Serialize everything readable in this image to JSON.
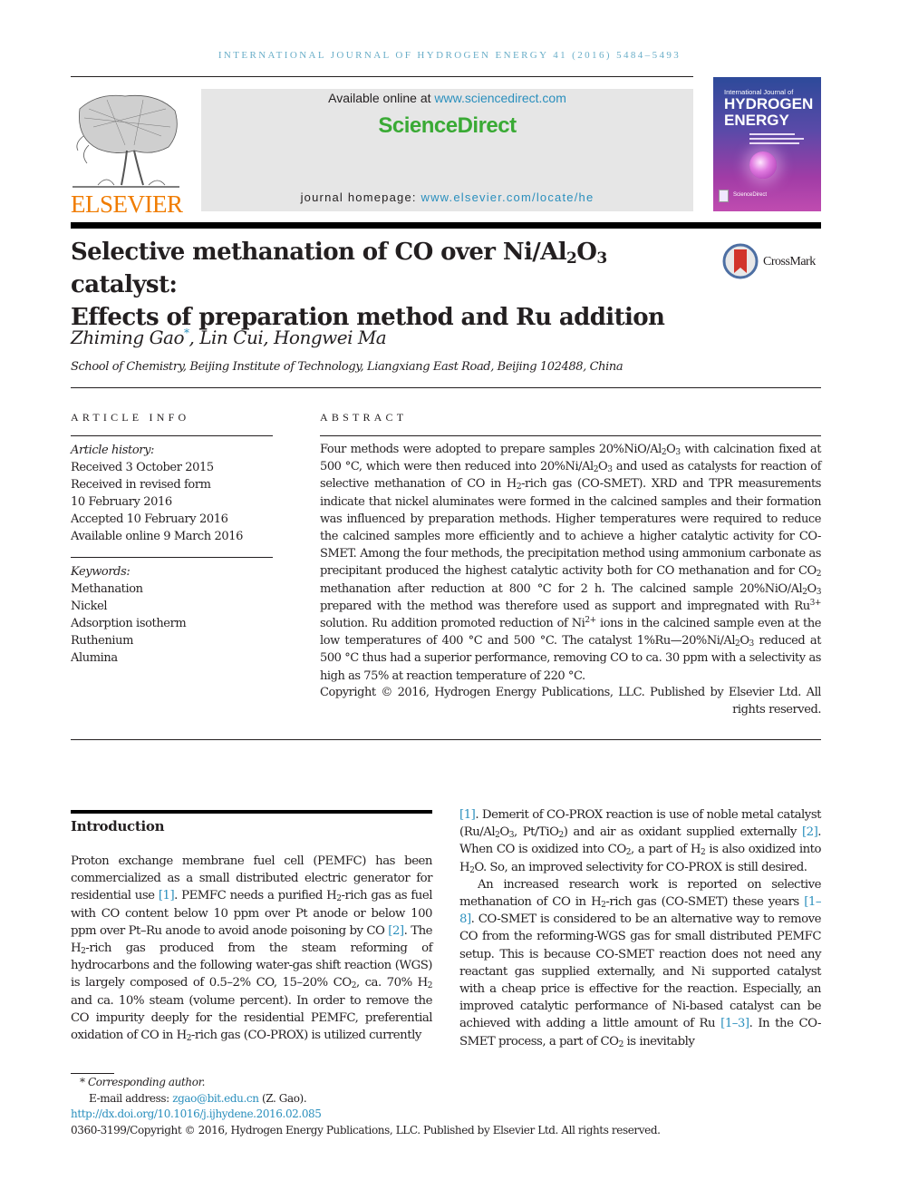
{
  "running_head": "INTERNATIONAL JOURNAL OF HYDROGEN ENERGY 41 (2016) 5484–5493",
  "publisher": {
    "logo_label": "ELSEVIER",
    "brand_color": "#f07c00"
  },
  "banner": {
    "available_prefix": "Available online at ",
    "available_link": "www.sciencedirect.com",
    "brand": "ScienceDirect",
    "brand_color": "#3aaa35",
    "homepage_prefix": "journal homepage: ",
    "homepage_link": "www.elsevier.com/locate/he"
  },
  "cover": {
    "line1": "International Journal of",
    "line2": "HYDROGEN",
    "line3": "ENERGY",
    "footer": "ScienceDirect"
  },
  "article": {
    "title_line1_a": "Selective methanation of CO over Ni/Al",
    "title_sub1": "2",
    "title_line1_b": "O",
    "title_sub2": "3",
    "title_line1_c": " catalyst:",
    "title_line2": "Effects of preparation method and Ru addition",
    "crossmark_label": "CrossMark",
    "authors": [
      {
        "name": "Zhiming Gao",
        "corresponding": "*"
      },
      {
        "name": ", Lin Cui, Hongwei Ma"
      }
    ],
    "affiliation": "School of Chemistry, Beijing Institute of Technology, Liangxiang East Road, Beijing 102488, China"
  },
  "article_info": {
    "heading": "ARTICLE INFO",
    "history_label": "Article history:",
    "history": [
      "Received 3 October 2015",
      "Received in revised form",
      "10 February 2016",
      "Accepted 10 February 2016",
      "Available online 9 March 2016"
    ],
    "keywords_label": "Keywords:",
    "keywords": [
      "Methanation",
      "Nickel",
      "Adsorption isotherm",
      "Ruthenium",
      "Alumina"
    ]
  },
  "abstract": {
    "heading": "ABSTRACT",
    "segments": {
      "s1": "Four methods were adopted to prepare samples 20%NiO/Al",
      "s2": "O",
      "s3": " with calcination fixed at 500 °C, which were then reduced into 20%Ni/Al",
      "s4": "O",
      "s5": " and used as catalysts for reaction of selective methanation of CO in H",
      "s6": "-rich gas (CO-SMET). XRD and TPR measurements indicate that nickel aluminates were formed in the calcined samples and their formation was influenced by preparation methods. Higher temperatures were required to reduce the calcined samples more efficiently and to achieve a higher catalytic activity for CO-SMET. Among the four methods, the precipitation method using ammonium carbonate as precipitant produced the highest catalytic activity both for CO methanation and for CO",
      "s7": " methanation after reduction at 800 °C for 2 h. The calcined sample 20%NiO/Al",
      "s8": "O",
      "s9": " prepared with the method was therefore used as support and impregnated with Ru",
      "s10": " solution. Ru addition promoted reduction of Ni",
      "s11": " ions in the calcined sample even at the low temperatures of 400 °C and 500 °C. The catalyst 1%Ru—20%Ni/Al",
      "s12": "O",
      "s13": " reduced at 500 °C thus had a superior performance, removing CO to ca. 30 ppm with a selectivity as high as 75% at reaction temperature of 220 °C.",
      "sub2": "2",
      "sub3": "3",
      "sup_ru": "3+",
      "sup_ni": "2+"
    },
    "copyright": "Copyright © 2016, Hydrogen Energy Publications, LLC. Published by Elsevier Ltd. All rights reserved."
  },
  "introduction": {
    "heading": "Introduction",
    "col1": {
      "a": "Proton exchange membrane fuel cell (PEMFC) has been commercialized as a small distributed electric generator for residential use ",
      "ref1": "[1]",
      "b": ". PEMFC needs a purified H",
      "c": "-rich gas as fuel with CO content below 10 ppm over Pt anode or below 100 ppm over Pt–Ru anode to avoid anode poisoning by CO ",
      "ref2": "[2]",
      "d": ". The H",
      "e": "-rich gas produced from the steam reforming of hydrocarbons and the following water-gas shift reaction (WGS) is largely composed of 0.5–2% CO, 15–20% CO",
      "f": ", ca. 70% H",
      "g": " and ca. 10% steam (volume percent). In order to remove the CO impurity deeply for the residential PEMFC, preferential oxidation of CO in H",
      "h": "-rich gas (CO-PROX) is utilized currently"
    },
    "col2": {
      "ref1": "[1]",
      "a": ". Demerit of CO-PROX reaction is use of noble metal catalyst (Ru/Al",
      "b": "O",
      "c": ", Pt/TiO",
      "d": ") and air as oxidant supplied externally ",
      "ref2": "[2]",
      "e": ". When CO is oxidized into CO",
      "f": ", a part of H",
      "g": " is also oxidized into H",
      "h": "O. So, an improved selectivity for CO-PROX is still desired.",
      "p2a": "An increased research work is reported on selective methanation of CO in H",
      "p2b": "-rich gas (CO-SMET) these years ",
      "ref3": "[1–8]",
      "p2c": ". CO-SMET is considered to be an alternative way to remove CO from the reforming-WGS gas for small distributed PEMFC setup. This is because CO-SMET reaction does not need any reactant gas supplied externally, and Ni supported catalyst with a cheap price is effective for the reaction. Especially, an improved catalytic performance of Ni-based catalyst can be achieved with adding a little amount of Ru ",
      "ref4": "[1–3]",
      "p2d": ". In the CO-SMET process, a part of CO",
      "p2e": " is inevitably"
    }
  },
  "footnotes": {
    "corresponding": "* Corresponding author.",
    "email_prefix": "E-mail address: ",
    "email": "zgao@bit.edu.cn",
    "email_suffix": " (Z. Gao).",
    "doi": "http://dx.doi.org/10.1016/j.ijhydene.2016.02.085",
    "issn_copyright": "0360-3199/Copyright © 2016, Hydrogen Energy Publications, LLC. Published by Elsevier Ltd. All rights reserved."
  },
  "colors": {
    "link": "#2a8fbd",
    "running_head": "#6aaec8",
    "banner_bg": "#e6e6e6"
  }
}
